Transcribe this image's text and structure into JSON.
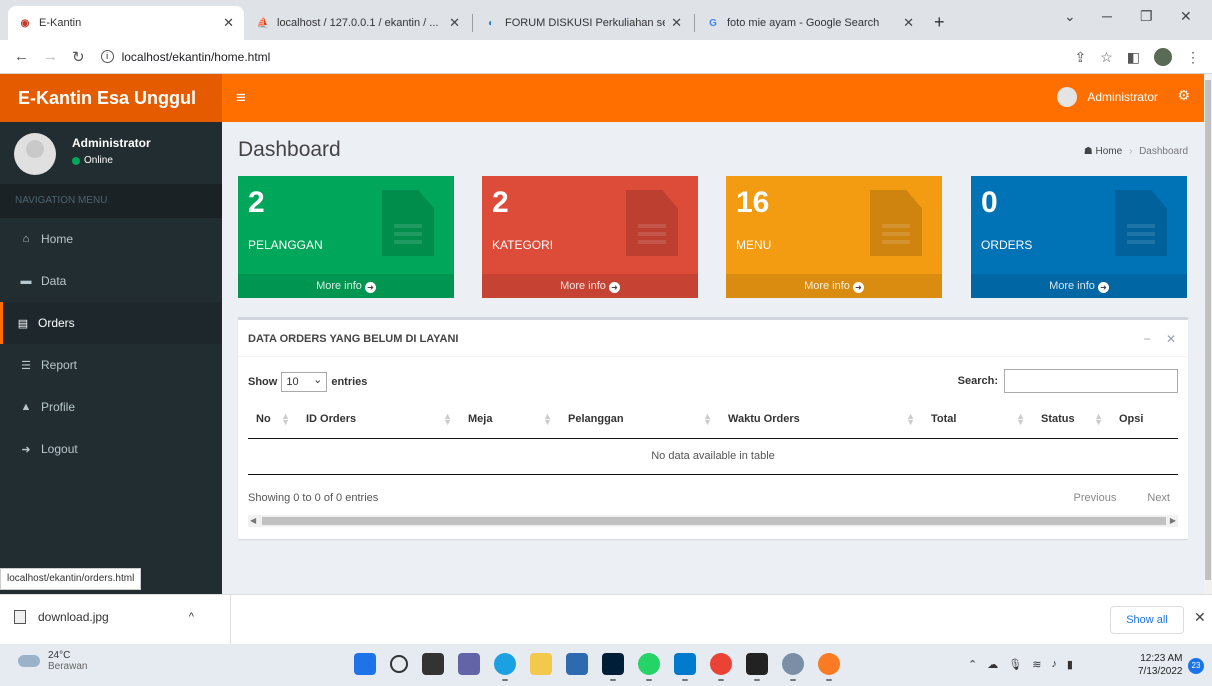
{
  "browser": {
    "tabs": [
      {
        "title": "E-Kantin",
        "active": true
      },
      {
        "title": "localhost / 127.0.0.1 / ekantin / ...",
        "active": false
      },
      {
        "title": "FORUM DISKUSI Perkuliahan se...",
        "active": false
      },
      {
        "title": "foto mie ayam - Google Search",
        "active": false
      }
    ],
    "url": "localhost/ekantin/home.html",
    "status_url": "localhost/ekantin/orders.html"
  },
  "app": {
    "brand": "E-Kantin Esa Unggul",
    "navbar_user": "Administrator",
    "accent_color": "#ff6f00"
  },
  "sidebar": {
    "user_name": "Administrator",
    "user_status": "Online",
    "nav_header": "NAVIGATION MENU",
    "items": [
      {
        "label": "Home",
        "icon": "home-icon",
        "glyph": "⌂",
        "active": false
      },
      {
        "label": "Data",
        "icon": "folder-icon",
        "glyph": "▬",
        "active": false
      },
      {
        "label": "Orders",
        "icon": "file-icon",
        "glyph": "▤",
        "active": true
      },
      {
        "label": "Report",
        "icon": "database-icon",
        "glyph": "☰",
        "active": false
      },
      {
        "label": "Profile",
        "icon": "lock-icon",
        "glyph": "▲",
        "active": false
      },
      {
        "label": "Logout",
        "icon": "sign-out-icon",
        "glyph": "➜",
        "active": false
      }
    ]
  },
  "page": {
    "title": "Dashboard",
    "breadcrumb_home": "Home",
    "breadcrumb_current": "Dashboard"
  },
  "stats": [
    {
      "value": "2",
      "label": "PELANGGAN",
      "link": "More info",
      "color": "#00a65a"
    },
    {
      "value": "2",
      "label": "KATEGORI",
      "link": "More info",
      "color": "#dd4b39"
    },
    {
      "value": "16",
      "label": "MENU",
      "link": "More info",
      "color": "#f39c12"
    },
    {
      "value": "0",
      "label": "ORDERS",
      "link": "More info",
      "color": "#0073b7"
    }
  ],
  "orders_box": {
    "title": "DATA ORDERS YANG BELUM DI LAYANI",
    "show_label": "Show",
    "entries_value": "10",
    "entries_label": "entries",
    "search_label": "Search:",
    "columns": [
      "No",
      "ID Orders",
      "Meja",
      "Pelanggan",
      "Waktu Orders",
      "Total",
      "Status",
      "Opsi"
    ],
    "empty_message": "No data available in table",
    "showing_text": "Showing 0 to 0 of 0 entries",
    "previous_label": "Previous",
    "next_label": "Next"
  },
  "downloads": {
    "file_name": "download.jpg",
    "show_all_label": "Show all"
  },
  "taskbar": {
    "temperature": "24°C",
    "weather_text": "Berawan",
    "time": "12:23 AM",
    "date": "7/13/2022",
    "notification_count": "23"
  }
}
